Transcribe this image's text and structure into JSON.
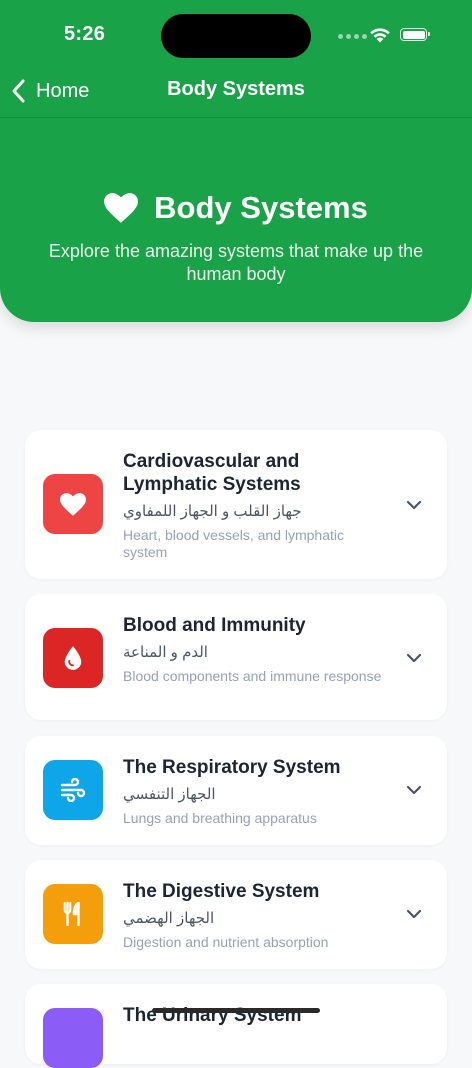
{
  "status_bar": {
    "time": "5:26"
  },
  "nav": {
    "back_label": "Home",
    "title": "Body Systems"
  },
  "hero": {
    "title": "Body Systems",
    "subtitle": "Explore the amazing systems that make up the human body",
    "icon": "heart-icon"
  },
  "colors": {
    "header_green": "#1aa248",
    "cardiovascular": "#ef4444",
    "blood": "#dc2626",
    "respiratory": "#0ea5e9",
    "digestive": "#f59e0b",
    "urinary": "#8b5cf6"
  },
  "systems": [
    {
      "title": "Cardiovascular and Lymphatic Systems",
      "arabic": "جهاز القلب و الجهاز اللمفاوي",
      "description": "Heart, blood vessels, and lymphatic system",
      "icon": "heart-icon"
    },
    {
      "title": "Blood and Immunity",
      "arabic": "الدم و المناعة",
      "description": "Blood components and immune response",
      "icon": "blood-drop-icon"
    },
    {
      "title": "The Respiratory System",
      "arabic": "الجهاز التنفسي",
      "description": "Lungs and breathing apparatus",
      "icon": "wind-icon"
    },
    {
      "title": "The Digestive System",
      "arabic": "الجهاز الهضمي",
      "description": "Digestion and nutrient absorption",
      "icon": "utensils-icon"
    },
    {
      "title": "The Urinary System",
      "arabic": "",
      "description": "",
      "icon": ""
    }
  ]
}
